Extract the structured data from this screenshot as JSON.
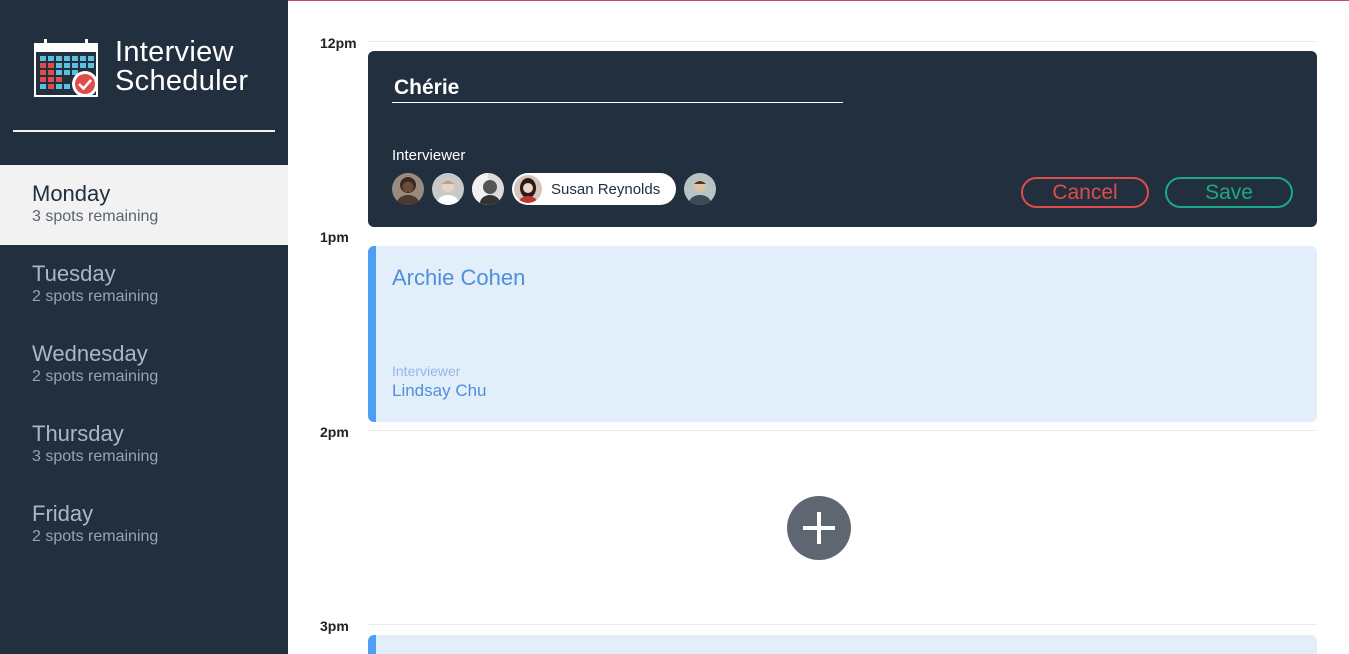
{
  "app": {
    "title_line1": "Interview",
    "title_line2": "Scheduler"
  },
  "days": [
    {
      "name": "Monday",
      "spots": "3 spots remaining",
      "selected": true
    },
    {
      "name": "Tuesday",
      "spots": "2 spots remaining",
      "selected": false
    },
    {
      "name": "Wednesday",
      "spots": "2 spots remaining",
      "selected": false
    },
    {
      "name": "Thursday",
      "spots": "3 spots remaining",
      "selected": false
    },
    {
      "name": "Friday",
      "spots": "2 spots remaining",
      "selected": false
    }
  ],
  "times": [
    "12pm",
    "1pm",
    "2pm",
    "3pm"
  ],
  "form": {
    "student_value": "Chérie",
    "interviewer_label": "Interviewer",
    "selected_interviewer": "Susan Reynolds",
    "cancel_label": "Cancel",
    "save_label": "Save"
  },
  "appointment": {
    "student": "Archie Cohen",
    "interviewer_label": "Interviewer",
    "interviewer": "Lindsay Chu"
  },
  "colors": {
    "sidebar": "#222f3e",
    "cancel": "#e04b4b",
    "save": "#1da883",
    "appointment_accent": "#4f9ef5",
    "appointment_bg": "#e3eefb"
  },
  "icons": {
    "logo": "calendar-check-icon",
    "add": "plus-icon"
  }
}
